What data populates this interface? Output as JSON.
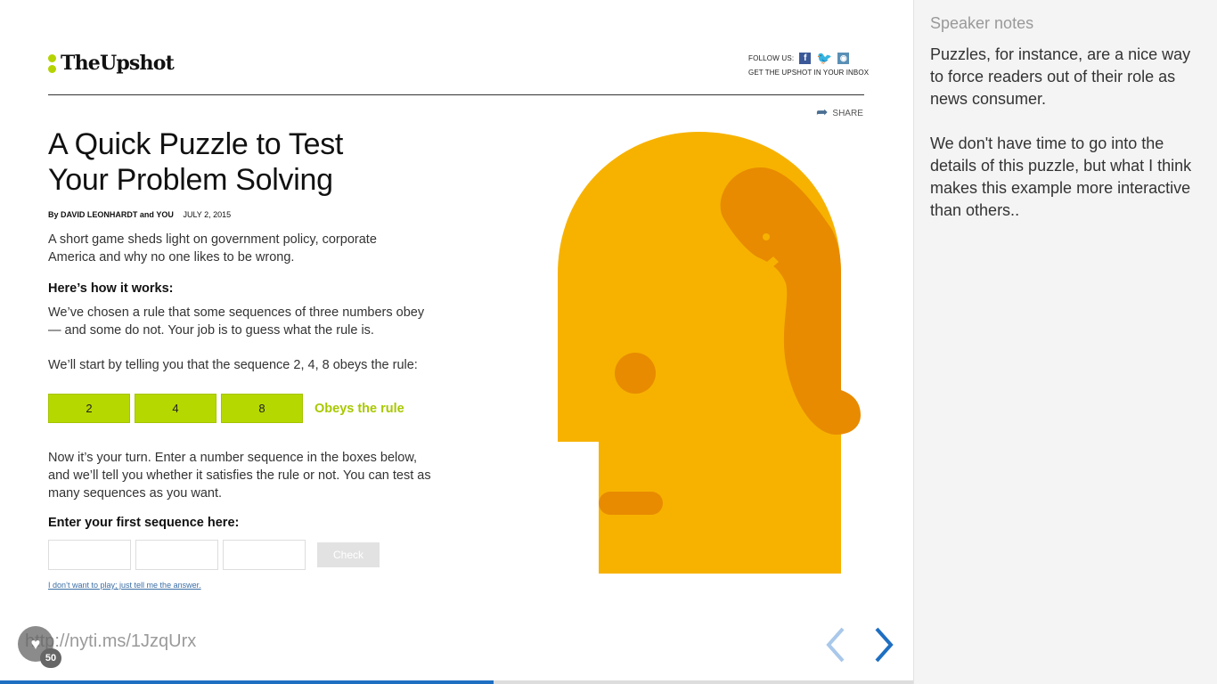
{
  "slide": {
    "site": {
      "logo_text": "TheUpshot",
      "follow_label": "FOLLOW US:",
      "facebook_icon": "f",
      "twitter_icon": "🐦",
      "rss_icon": "◉",
      "inbox_label": "GET THE UPSHOT IN YOUR INBOX",
      "share_label": "SHARE"
    },
    "article": {
      "headline_line1": "A Quick Puzzle to Test",
      "headline_line2": "Your Problem Solving",
      "byline_prefix": "By",
      "byline_author": "DAVID LEONHARDT",
      "byline_and": "and",
      "byline_coauthor": "YOU",
      "date": "JULY 2, 2015",
      "summary": "A short game sheds light on government policy, corporate America and why no one likes to be wrong.",
      "how_heading": "Here’s how it works:",
      "how_text": "We’ve chosen a rule that some sequences of three numbers obey — and some do not. Your job is to guess what the rule is.",
      "start_text": "We’ll start by telling you that the sequence 2, 4, 8 obeys the rule:",
      "sequence": [
        "2",
        "4",
        "8"
      ],
      "obeys_label": "Obeys the rule",
      "turn_text": "Now it’s your turn. Enter a number sequence in the boxes below, and we’ll tell you whether it satisfies the rule or not. You can test as many sequences as you want.",
      "enter_heading": "Enter your first sequence here:",
      "check_label": "Check",
      "answer_link": "I don’t want to play; just tell me the answer."
    },
    "footer": {
      "url": "http://nyti.ms/1JzqUrx",
      "like_count": "50",
      "progress_fraction": 0.54
    },
    "colors": {
      "accent_green": "#b5d800",
      "head_yellow": "#f7b200",
      "head_orange": "#e88b00",
      "nav_blue": "#1e6fc2"
    }
  },
  "notes": {
    "title": "Speaker notes",
    "text": "Puzzles, for instance, are a nice way to force readers out of their role as news consumer.\n\nWe don't have time to go into the details of this puzzle, but what I think makes this example more interactive than others.."
  }
}
